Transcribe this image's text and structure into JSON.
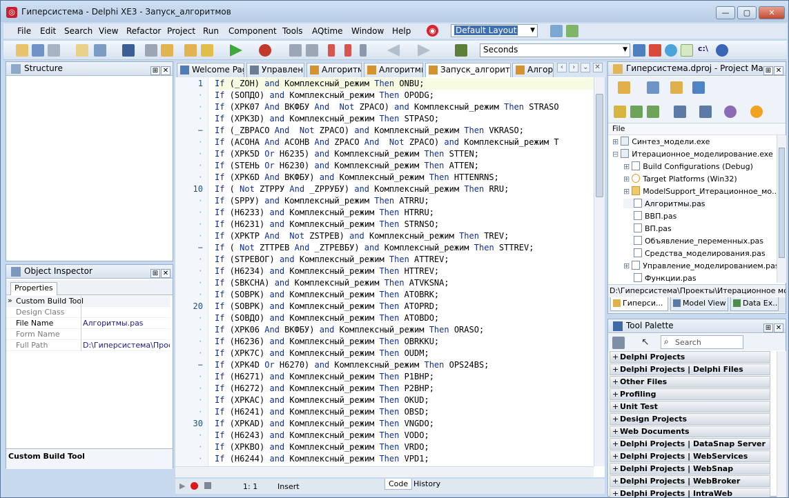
{
  "window": {
    "title": "Гиперсистема - Delphi XE3 - Запуск_алгоритмов",
    "min": "—",
    "max": "▢",
    "close": "✕"
  },
  "menu": [
    "File",
    "Edit",
    "Search",
    "View",
    "Refactor",
    "Project",
    "Run",
    "Component",
    "Tools",
    "AQtime",
    "Window",
    "Help"
  ],
  "layout_combo": "Default Layout",
  "speed_combo": "Seconds",
  "structure": {
    "title": "Structure"
  },
  "object_inspector": {
    "title": "Object Inspector",
    "tab": "Properties",
    "rows": [
      {
        "key": "Custom Build Tool",
        "value": ""
      },
      {
        "key": "Design Class",
        "value": ""
      },
      {
        "key": "File Name",
        "value": "Алгоритмы.pas"
      },
      {
        "key": "Form Name",
        "value": ""
      },
      {
        "key": "Full Path",
        "value": "D:\\Гиперсистема\\Проекты"
      }
    ],
    "footer": "Custom Build Tool"
  },
  "tabs": [
    "Welcome Page",
    "Управление",
    "Алгоритмы",
    "Алгоритмы_",
    "Запуск_алгоритмов",
    "Алгори"
  ],
  "active_tab": 4,
  "editor": {
    "line_numbers": [
      {
        "row": 0,
        "label": "1"
      },
      {
        "row": 9,
        "label": "10"
      },
      {
        "row": 19,
        "label": "20"
      },
      {
        "row": 29,
        "label": "30"
      }
    ],
    "lines": [
      "If (_ZOH) and Комплексный_режим Then ONBU;",
      "If (SOПДО) and Комплексный_режим Then OPODG;",
      "If (XPK07 And ВКФБУ And  Not ZPACO) and Комплексный_режим Then STRASO",
      "If (XPK3D) and Комплексный_режим Then STPASO;",
      "If (_ZBPACO And  Not ZPACO) and Комплексный_режим Then VKRASO;",
      "If (ACOHA And ACOHB And ZPACO And  Not ZPACO) and Комплексный_режим T",
      "If (XPK5D Or H6235) and Комплексный_режим Then STTEN;",
      "If (STEHЬ Or H6230) and Комплексный_режим Then ATTEN;",
      "If (XPK6D And ВКФБУ) and Комплексный_режим Then HTTENRNS;",
      "If ( Not ZTPPУ And _ZPPУБУ) and Комплексный_режим Then RRU;",
      "If (SPPУ) and Комплексный_режим Then ATRRU;",
      "If (H6233) and Комплексный_режим Then HTRRU;",
      "If (H6231) and Комплексный_режим Then STRNSO;",
      "If (XPKTP And  Not ZSTPEB) and Комплексный_режим Then TREV;",
      "If ( Not ZTTPEB And _ZTPEBБУ) and Комплексный_режим Then STTREV;",
      "If (STPEBОГ) and Комплексный_режим Then ATTREV;",
      "If (H6234) and Комплексный_режим Then HTTREV;",
      "If (SBKCHA) and Комплексный_режим Then ATVKSNA;",
      "If (SOBPK) and Комплексный_режим Then ATOBRK;",
      "If (SOBPK) and Комплексный_режим Then ATOPRD;",
      "If (SOBДО) and Комплексный_режим Then ATOBDO;",
      "If (XPK06 And ВКФБУ) and Комплексный_режим Then ORASO;",
      "If (H6236) and Комплексный_режим Then OBRKKU;",
      "If (XPK7C) and Комплексный_режим Then OUDM;",
      "If (XPK4D Or H6270) and Комплексный_режим Then OPS24BS;",
      "If (H6271) and Комплексный_режим Then P1BHP;",
      "If (H6272) and Комплексный_режим Then P2BHP;",
      "If (XPKAC) and Комплексный_режим Then OKUD;",
      "If (H6241) and Комплексный_режим Then OBSD;",
      "If (XPKAD) and Комплексный_режим Then VNGDO;",
      "If (H6243) and Комплексный_режим Then VODO;",
      "If (XPKBO) and Комплексный_режим Then VRDO;",
      "If (H6244) and Комплексный_режим Then VPD1;"
    ]
  },
  "status": {
    "position": "1:  1",
    "mode": "Insert",
    "tab_code": "Code",
    "tab_history": "History"
  },
  "project_manager": {
    "title": "Гиперсистема.dproj - Project Mana...",
    "column": "File",
    "nodes": [
      {
        "label": "Синтез_модели.exe",
        "indent": 0,
        "expand": "+"
      },
      {
        "label": "Итерационное_моделирование.exe",
        "indent": 0,
        "expand": "−"
      },
      {
        "label": "Build Configurations (Debug)",
        "indent": 1,
        "expand": "+"
      },
      {
        "label": "Target Platforms (Win32)",
        "indent": 1,
        "expand": "+"
      },
      {
        "label": "ModelSupport_Итерационное_мо...",
        "indent": 1,
        "expand": "+"
      },
      {
        "label": "Алгоритмы.pas",
        "indent": 1,
        "expand": ""
      },
      {
        "label": "ВВП.pas",
        "indent": 1,
        "expand": ""
      },
      {
        "label": "ВП.pas",
        "indent": 1,
        "expand": ""
      },
      {
        "label": "Объявление_переменных.pas",
        "indent": 1,
        "expand": ""
      },
      {
        "label": "Средства_моделирования.pas",
        "indent": 1,
        "expand": ""
      },
      {
        "label": "Управление_моделированием.pas",
        "indent": 1,
        "expand": "+"
      },
      {
        "label": "Функции.pas",
        "indent": 1,
        "expand": ""
      }
    ],
    "path": "D:\\Гиперсистема\\Проекты\\Итерационное моделир",
    "bottom_tabs": [
      "Гиперси...",
      "Model View",
      "Data Ex..."
    ]
  },
  "tool_palette": {
    "title": "Tool Palette",
    "search_placeholder": "Search",
    "categories": [
      "Delphi Projects",
      "Delphi Projects | Delphi Files",
      "Other Files",
      "Profiling",
      "Unit Test",
      "Design Projects",
      "Web Documents",
      "Delphi Projects | DataSnap Server",
      "Delphi Projects | WebServices",
      "Delphi Projects | WebSnap",
      "Delphi Projects | WebBroker",
      "Delphi Projects | IntraWeb"
    ]
  },
  "colors": {
    "keyword": "#0e2e94",
    "line_number": "#24507a",
    "frame": "#c6d9ee"
  }
}
